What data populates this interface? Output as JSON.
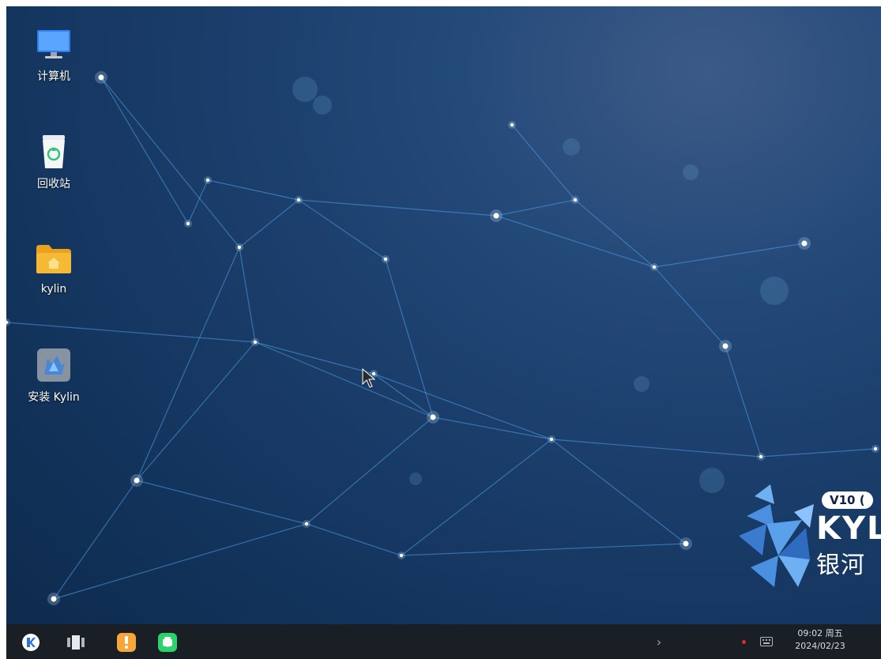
{
  "desktop": {
    "icons": [
      {
        "label": "计算机",
        "icon": "computer-icon"
      },
      {
        "label": "回收站",
        "icon": "trash-icon"
      },
      {
        "label": "kylin",
        "icon": "home-folder-icon"
      },
      {
        "label": "安装 Kylin",
        "icon": "installer-icon"
      }
    ],
    "branding": {
      "version": "V10 (",
      "name_en": "KYL",
      "name_cn": "银河"
    }
  },
  "taskbar": {
    "start_icon": "kylin-start-icon",
    "apps": [
      "multitask-view-icon",
      "app-store-icon",
      "chat-app-icon"
    ],
    "tray_expand": "›",
    "clock": {
      "time": "09:02 周五",
      "date": "2024/02/23"
    }
  },
  "colors": {
    "taskbar_bg": "#1a1f26",
    "wallpaper_dark": "#0e2a4c",
    "wallpaper_light": "#3d5a86",
    "star_line": "#4fa3e8",
    "folder_yellow": "#f6b935",
    "chat_green": "#2bd36a",
    "store_orange": "#f7a73a"
  }
}
